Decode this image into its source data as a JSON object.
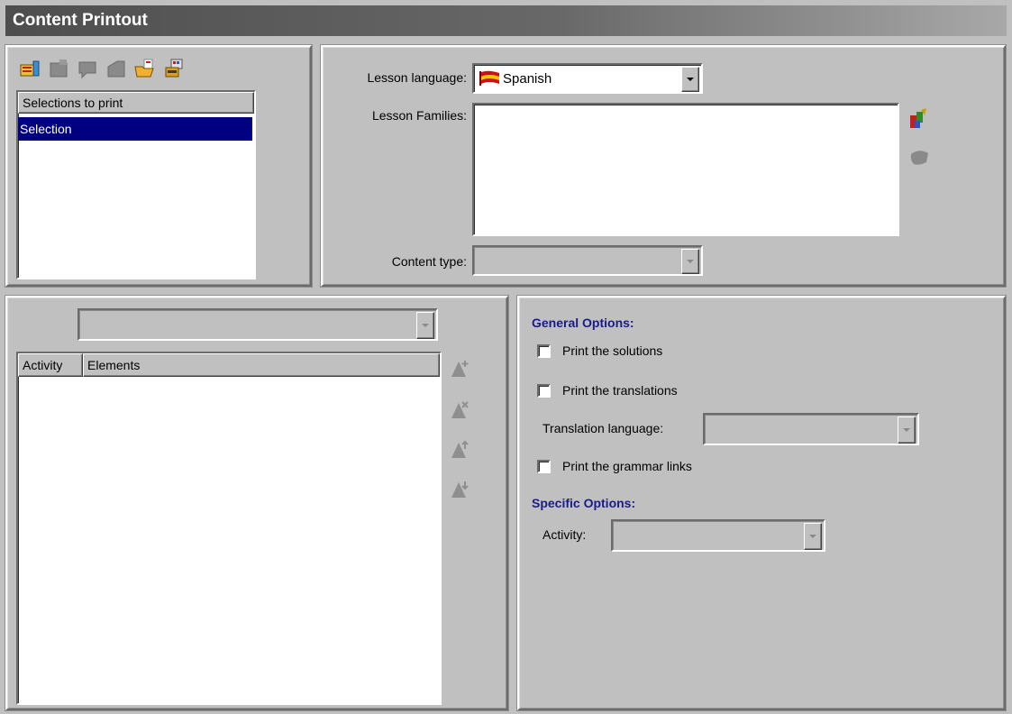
{
  "window": {
    "title": "Content Printout"
  },
  "selections": {
    "header": "Selections to print",
    "items": [
      "Selection"
    ]
  },
  "lesson": {
    "language_label": "Lesson language:",
    "language_value": "Spanish",
    "families_label": "Lesson Families:",
    "content_type_label": "Content type:",
    "content_type_value": ""
  },
  "activities": {
    "filter_value": "",
    "columns": [
      "Activity",
      "Elements"
    ]
  },
  "options": {
    "general_title": "General Options:",
    "print_solutions": "Print the solutions",
    "print_translations": "Print the translations",
    "translation_language_label": "Translation language:",
    "translation_language_value": "",
    "print_grammar": "Print the grammar links",
    "specific_title": "Specific Options:",
    "activity_label": "Activity:",
    "activity_value": ""
  },
  "checkboxes": {
    "print_solutions": false,
    "print_translations": false,
    "print_grammar": false
  },
  "icons": {
    "toolbar": [
      "new-selection-icon",
      "edit-selection-icon",
      "comment-icon",
      "folder-icon",
      "open-folder-icon",
      "print-icon"
    ],
    "families": [
      "add-family-icon",
      "remove-family-icon"
    ],
    "activity_side": [
      "add-activity-icon",
      "delete-activity-icon",
      "move-up-icon",
      "move-down-icon"
    ]
  },
  "colors": {
    "selection_highlight": "#000080",
    "section_title": "#1a1a8c",
    "flag_red": "#cc1111",
    "flag_yellow": "#f5c400"
  }
}
